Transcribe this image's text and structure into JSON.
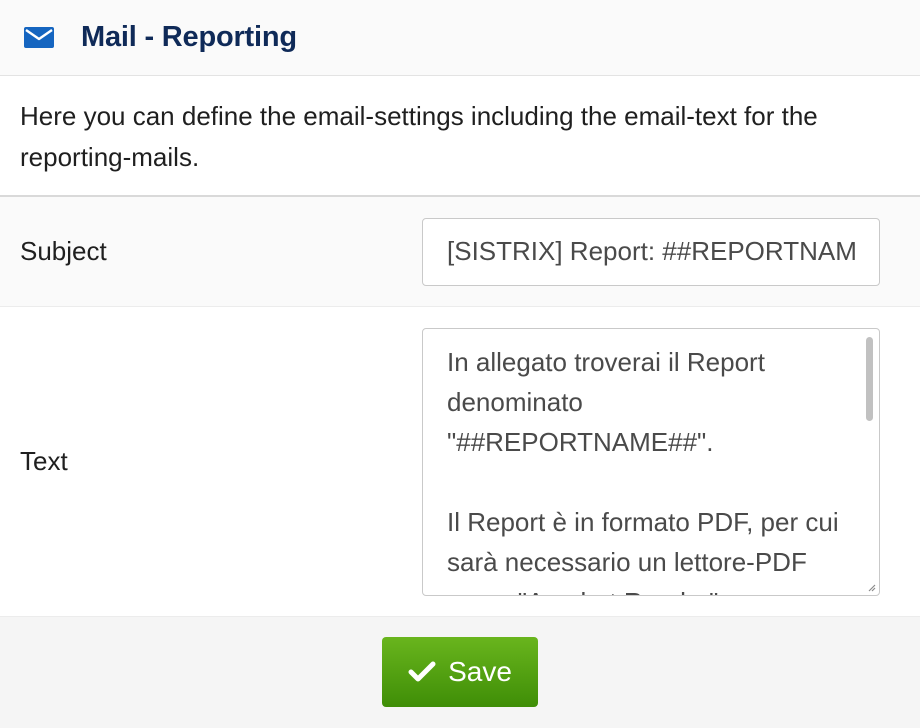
{
  "header": {
    "title": "Mail - Reporting",
    "icon": "envelope-icon"
  },
  "intro": {
    "text": "Here you can define the email-settings including the email-text for the reporting-mails."
  },
  "form": {
    "subject_label": "Subject",
    "subject_value": "[SISTRIX] Report: ##REPORTNAME##",
    "text_label": "Text",
    "text_value": "In allegato troverai il Report denominato \"##REPORTNAME##\".\n\nIl Report è in formato PDF, per cui sarà necessario un lettore-PDF come \"Acrobat Reader\""
  },
  "footer": {
    "save_label": "Save",
    "save_icon": "check-icon"
  },
  "colors": {
    "accent": "#0f2a58",
    "icon": "#1565c0",
    "button": "#4e9b0e"
  }
}
